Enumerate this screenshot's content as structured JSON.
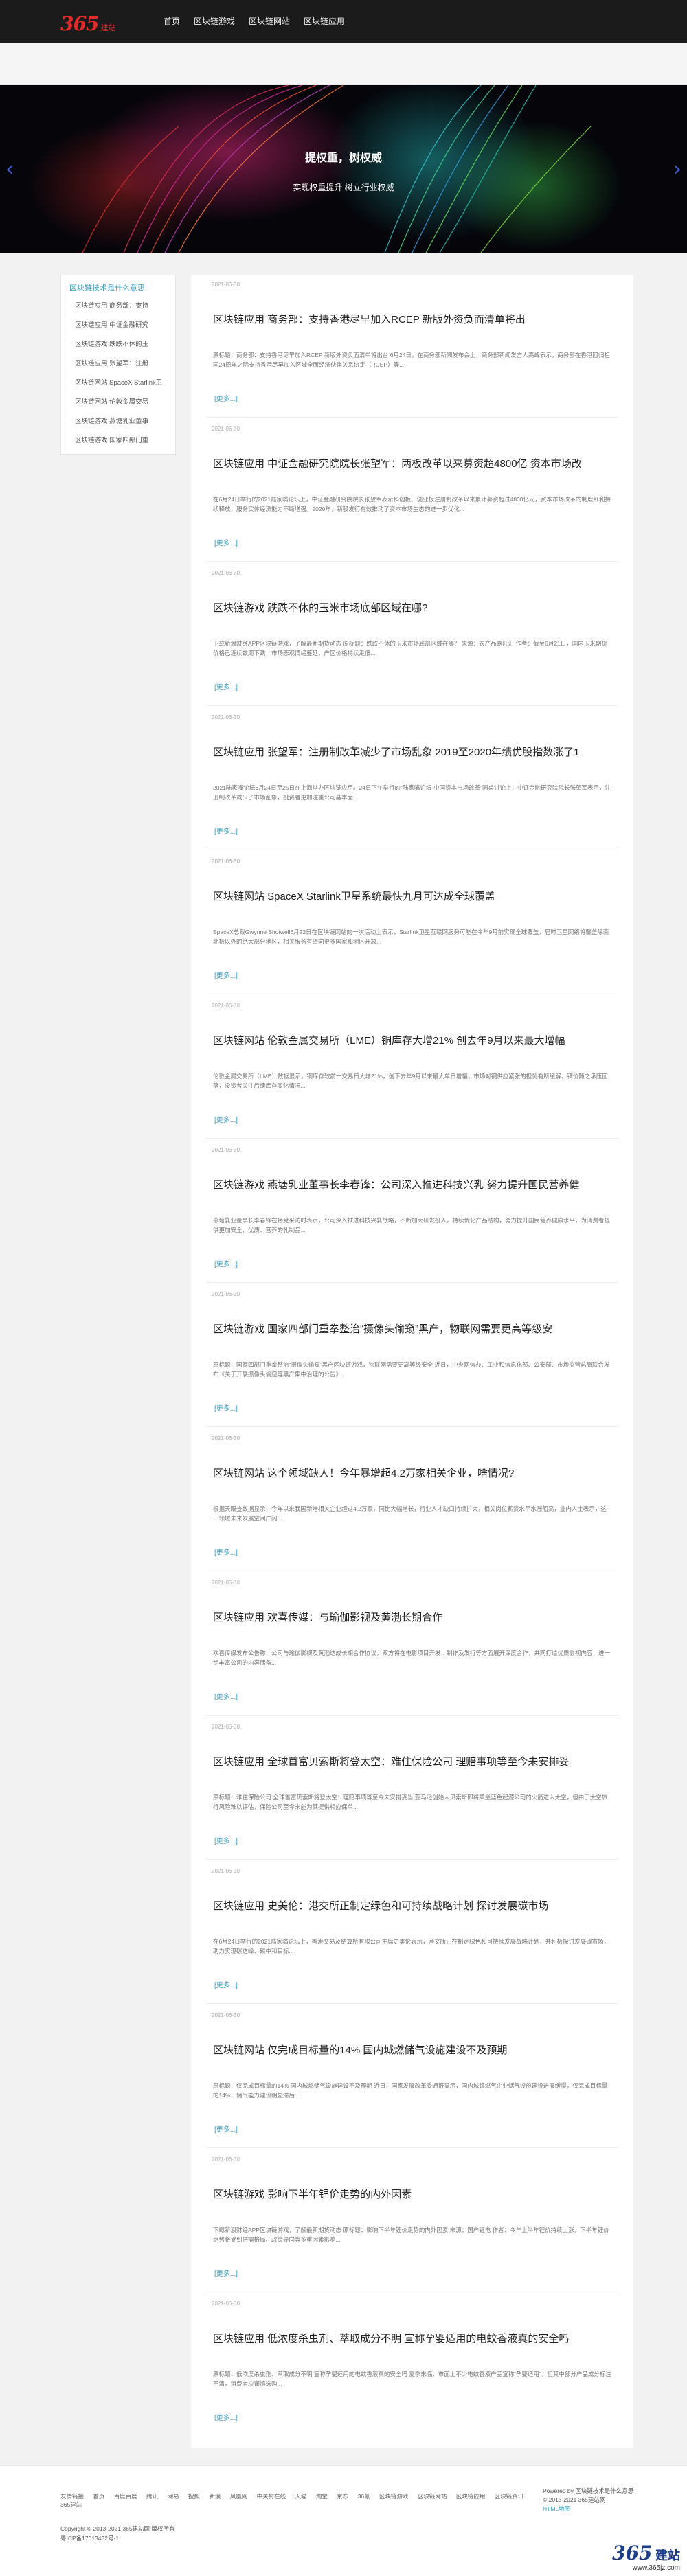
{
  "header": {
    "logo_number": "365",
    "logo_sub": "建站",
    "nav": [
      "首页",
      "区块链游戏",
      "区块链网站",
      "区块链应用"
    ]
  },
  "banner": {
    "title": "提权重，树权威",
    "subtitle": "实现权重提升 树立行业权威"
  },
  "sidebar": {
    "title": "区块链技术是什么意思",
    "items": [
      "区块链应用 商务部：支持",
      "区块链应用 中证金融研究",
      "区块链游戏 跌跌不休的玉",
      "区块链应用 张望军：注册",
      "区块链网站 SpaceX Starlink卫",
      "区块链网站 伦敦金属交易",
      "区块链游戏 燕塘乳业董事",
      "区块链游戏 国家四部门重"
    ]
  },
  "more_label": "[更多...]",
  "articles": [
    {
      "date": "2021-06-30",
      "title": "区块链应用 商务部：支持香港尽早加入RCEP 新版外资负面清单将出",
      "text": "原标题：商务部：支持香港尽早加入RCEP 新版外资负面清单将出台 6月24日，在商务部新闻发布会上，商务部新闻发言人高峰表示，商务部在香港回归祖国24周年之际支持香港尽早加入区域全面经济伙伴关系协定（RCEP）等..."
    },
    {
      "date": "2021-06-30",
      "title": "区块链应用 中证金融研究院院长张望军：两板改革以来募资超4800亿 资本市场改",
      "text": "在6月24日举行的2021陆家嘴论坛上，中证金融研究院院长张望军表示科创板、创业板注册制改革以来累计募资超过4800亿元，资本市场改革的制度红利持续释放，服务实体经济能力不断增强。2020年，新股发行有效推动了资本市场生态的进一步优化..."
    },
    {
      "date": "2021-06-30",
      "title": "区块链游戏 跌跌不休的玉米市场底部区域在哪?",
      "text": "下载新浪财经APP区块链游戏，了解最新期货动态 原标题：跌跌不休的玉米市场底部区域在哪？ 来源：农产品嘉旺汇 作者：截至6月21日，国内玉米期货价格已连续数周下跌，市场悲观情绪蔓延，产区价格持续走低..."
    },
    {
      "date": "2021-06-30",
      "title": "区块链应用 张望军：注册制改革减少了市场乱象 2019至2020年绩优股指数涨了1",
      "text": "2021陆家嘴论坛6月24日至25日在上海举办区块链应用。24日下午举行的“陆家嘴论坛·中国资本市场改革”圆桌讨论上，中证金融研究院院长张望军表示，注册制改革减少了市场乱象，投资者更加注重公司基本面..."
    },
    {
      "date": "2021-06-30",
      "title": "区块链网站 SpaceX Starlink卫星系统最快九月可达成全球覆盖",
      "text": "SpaceX总裁Gwynne Shotwell6月22日在区块链网站的一次活动上表示，Starlink卫星互联网服务可能在今年9月前实现全球覆盖，届时卫星网络将覆盖除南北极以外的绝大部分地区，相关服务有望向更多国家和地区开放..."
    },
    {
      "date": "2021-06-30",
      "title": "区块链网站 伦敦金属交易所（LME）铜库存大增21% 创去年9月以来最大增幅",
      "text": "伦敦金属交易所（LME）数据显示，铜库存较前一交易日大增21%，创下去年9月以来最大单日增幅，市场对铜供应紧张的担忧有所缓解，铜价随之承压回落，投资者关注后续库存变化情况..."
    },
    {
      "date": "2021-06-30",
      "title": "区块链游戏 燕塘乳业董事长李春锋：公司深入推进科技兴乳 努力提升国民营养健",
      "text": "燕塘乳业董事长李春锋在接受采访时表示，公司深入推进科技兴乳战略，不断加大研发投入，持续优化产品结构，努力提升国民营养健康水平，为消费者提供更加安全、优质、营养的乳制品..."
    },
    {
      "date": "2021-06-30",
      "title": "区块链游戏 国家四部门重拳整治“摄像头偷窥”黑产，物联网需要更高等级安",
      "text": "原标题：国家四部门重拳整治“摄像头偷窥”黑产区块链游戏，物联网需要更高等级安全 近日，中央网信办、工业和信息化部、公安部、市场监管总局联合发布《关于开展摄像头偷窥等黑产集中治理的公告》..."
    },
    {
      "date": "2021-06-30",
      "title": "区块链网站 这个领域缺人！今年暴增超4.2万家相关企业，啥情况?",
      "text": "根据天眼查数据显示，今年以来我国新增相关企业超过4.2万家，同比大幅增长，行业人才缺口持续扩大，相关岗位薪资水平水涨船高，业内人士表示，这一领域未来发展空间广阔..."
    },
    {
      "date": "2021-06-30",
      "title": "区块链应用 欢喜传媒：与瑜伽影视及黄渤长期合作",
      "text": "欢喜传媒发布公告称，公司与瑜伽影视及黄渤达成长期合作协议，双方将在电影项目开发、制作及发行等方面展开深度合作，共同打造优质影视内容，进一步丰富公司的内容储备..."
    },
    {
      "date": "2021-06-30",
      "title": "区块链应用 全球首富贝索斯将登太空：难住保险公司 理赔事项等至今未安排妥",
      "text": "原标题：难住保险公司 全球首富贝索斯将登太空：理赔事项等至今未安排妥当 亚马逊创始人贝索斯即将乘坐蓝色起源公司的火箭进入太空，但由于太空旅行风险难以评估，保险公司至今未能为其提供相应保单..."
    },
    {
      "date": "2021-06-30",
      "title": "区块链应用 史美伦：港交所正制定绿色和可持续战略计划 探讨发展碳市场",
      "text": "在6月24日举行的2021陆家嘴论坛上，香港交易及结算所有限公司主席史美伦表示，港交所正在制定绿色和可持续发展战略计划，并积极探讨发展碳市场，助力实现碳达峰、碳中和目标..."
    },
    {
      "date": "2021-06-30",
      "title": "区块链网站 仅完成目标量的14% 国内城燃储气设施建设不及预期",
      "text": "原标题：仅完成目标量的14% 国内城燃储气设施建设不及预期 近日，国家发展改革委通报显示，国内城镇燃气企业储气设施建设进展缓慢，仅完成目标量的14%，储气能力建设明显滞后..."
    },
    {
      "date": "2021-06-30",
      "title": "区块链游戏 影响下半年锂价走势的内外因素",
      "text": "下载新浪财经APP区块链游戏，了解最新期货动态 原标题：影响下半年锂价走势的内外因素 来源：国产锂电 作者：今年上半年锂价持续上涨，下半年锂价走势将受到供需格局、政策导向等多重因素影响..."
    },
    {
      "date": "2021-06-30",
      "title": "区块链应用 低浓度杀虫剂、萃取成分不明 宣称孕婴适用的电蚊香液真的安全吗",
      "text": "原标题：低浓度杀虫剂、萃取成分不明 宣称孕婴适用的电蚊香液真的安全吗 夏季来临，市面上不少电蚊香液产品宣称“孕婴适用”，但其中部分产品成分标注不清，消费者应谨慎选购..."
    }
  ],
  "footer": {
    "links": [
      "友情链接",
      "首页",
      "百度百度",
      "腾讯",
      "网易",
      "搜狐",
      "新浪",
      "凤凰网",
      "中关村在线",
      "天猫",
      "淘宝",
      "京东",
      "36氪",
      "区块链游戏",
      "区块链网站",
      "区块链应用",
      "区块链资讯",
      "365建站"
    ],
    "copyright_line1": "Copyright © 2013-2021 365建站网 版权所有",
    "copyright_line2": "粤ICP备17013432号-1",
    "powered_line1": "Powered by 区块链技术是什么意思",
    "powered_line2": "© 2013-2021 365建站网",
    "powered_line3": "HTML地图"
  },
  "watermark": {
    "number": "365",
    "text": "建站",
    "url": "www.365jz.com"
  }
}
